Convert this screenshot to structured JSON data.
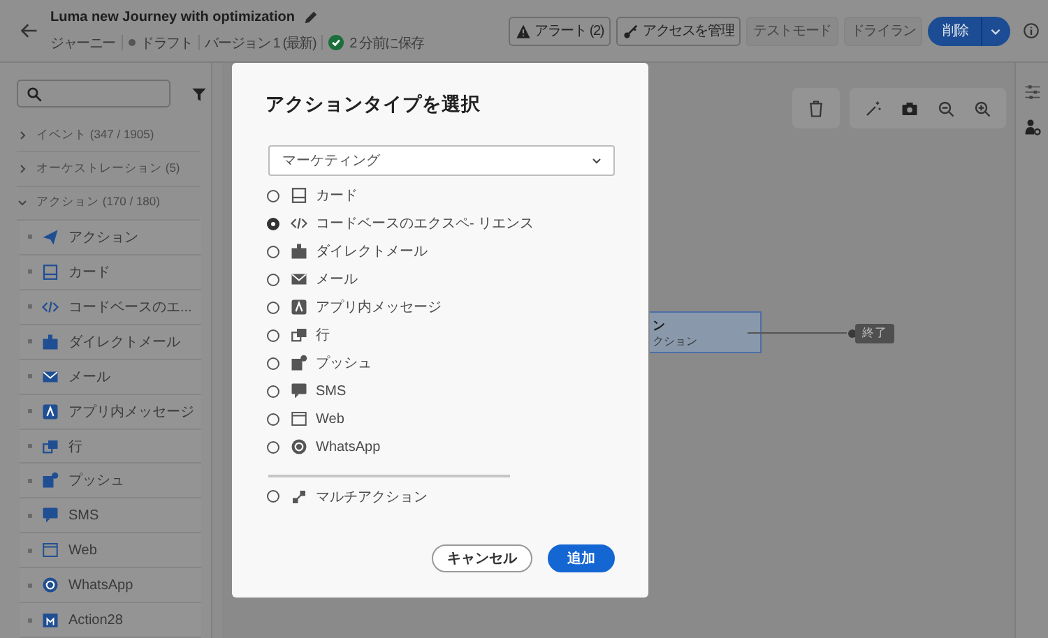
{
  "header": {
    "title": "Luma new Journey with optimization",
    "type": "ジャーニー",
    "status": "ドラフト",
    "version": "バージョン 1 (最新)",
    "saved": "2 分前に保存",
    "buttons": [
      {
        "label": "アラート (2)",
        "kind": "alert",
        "disabled": false
      },
      {
        "label": "アクセスを管理",
        "kind": "access",
        "disabled": false
      },
      {
        "label": "テストモード",
        "kind": "plain",
        "disabled": true
      },
      {
        "label": "ドライラン",
        "kind": "plain",
        "disabled": true
      },
      {
        "label": "削除",
        "kind": "primary",
        "disabled": false
      }
    ]
  },
  "sidebar": {
    "categories": [
      {
        "label": "イベント (347 / 1905)",
        "expanded": false
      },
      {
        "label": "オーケストレーション (5)",
        "expanded": false
      },
      {
        "label": "アクション (170 / 180)",
        "expanded": true,
        "children": [
          {
            "label": "アクション",
            "kind": "action"
          },
          {
            "label": "カード",
            "kind": "card"
          },
          {
            "label": "コードベースのエ...",
            "kind": "code"
          },
          {
            "label": "ダイレクトメール",
            "kind": "direct-mail"
          },
          {
            "label": "メール",
            "kind": "email"
          },
          {
            "label": "アプリ内メッセージ",
            "kind": "in-app"
          },
          {
            "label": "行",
            "kind": "line"
          },
          {
            "label": "プッシュ",
            "kind": "push"
          },
          {
            "label": "SMS",
            "kind": "sms"
          },
          {
            "label": "Web",
            "kind": "web"
          },
          {
            "label": "WhatsApp",
            "kind": "whatsapp"
          },
          {
            "label": "Action28",
            "kind": "custom"
          }
        ]
      }
    ]
  },
  "canvas": {
    "action_node": {
      "title": "ン",
      "subtitle": "クション"
    },
    "end_node": {
      "label": "終了"
    }
  },
  "dialog": {
    "title": "アクションタイプを選択",
    "dropdown": {
      "value": "マーケティング"
    },
    "options": [
      {
        "label": "カード",
        "kind": "card",
        "selected": false
      },
      {
        "label": "コードベースのエクスペ- リエンス",
        "kind": "code",
        "selected": true
      },
      {
        "label": "ダイレクトメール",
        "kind": "direct-mail",
        "selected": false
      },
      {
        "label": "メール",
        "kind": "email",
        "selected": false
      },
      {
        "label": "アプリ内メッセージ",
        "kind": "in-app",
        "selected": false
      },
      {
        "label": "行",
        "kind": "line",
        "selected": false
      },
      {
        "label": "プッシュ",
        "kind": "push",
        "selected": false
      },
      {
        "label": "SMS",
        "kind": "sms",
        "selected": false
      },
      {
        "label": "Web",
        "kind": "web",
        "selected": false
      },
      {
        "label": "WhatsApp",
        "kind": "whatsapp",
        "selected": false
      }
    ],
    "multi_action": {
      "label": "マルチアクション",
      "kind": "multi",
      "selected": false
    },
    "cancel": "キャンセル",
    "confirm": "追加"
  }
}
